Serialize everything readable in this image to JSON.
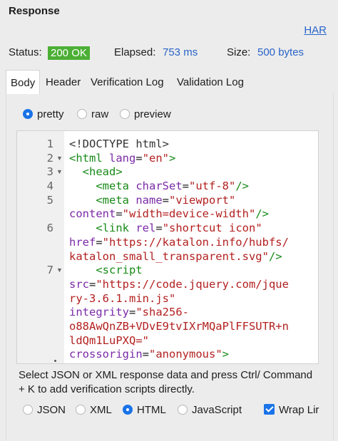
{
  "title": "Response",
  "har_link": "HAR",
  "status": {
    "status_label": "Status:",
    "status_value": "200 OK",
    "elapsed_label": "Elapsed:",
    "elapsed_value": "753 ms",
    "size_label": "Size:",
    "size_value": "500 bytes"
  },
  "tabs": [
    "Body",
    "Header",
    "Verification Log",
    "Validation Log"
  ],
  "view_modes": [
    "pretty",
    "raw",
    "preview"
  ],
  "selected_view_mode": "pretty",
  "gutter": [
    "1",
    "2",
    "3",
    "4",
    "5",
    "",
    "6",
    "",
    "",
    "7",
    "",
    "",
    "",
    "",
    "",
    ""
  ],
  "hint": "Select JSON or XML response data and press Ctrl/ Command + K to add verification scripts directly.",
  "formats": [
    "JSON",
    "XML",
    "HTML",
    "JavaScript"
  ],
  "selected_format": "HTML",
  "wrap_label": "Wrap Lir",
  "wrap_checked": true
}
